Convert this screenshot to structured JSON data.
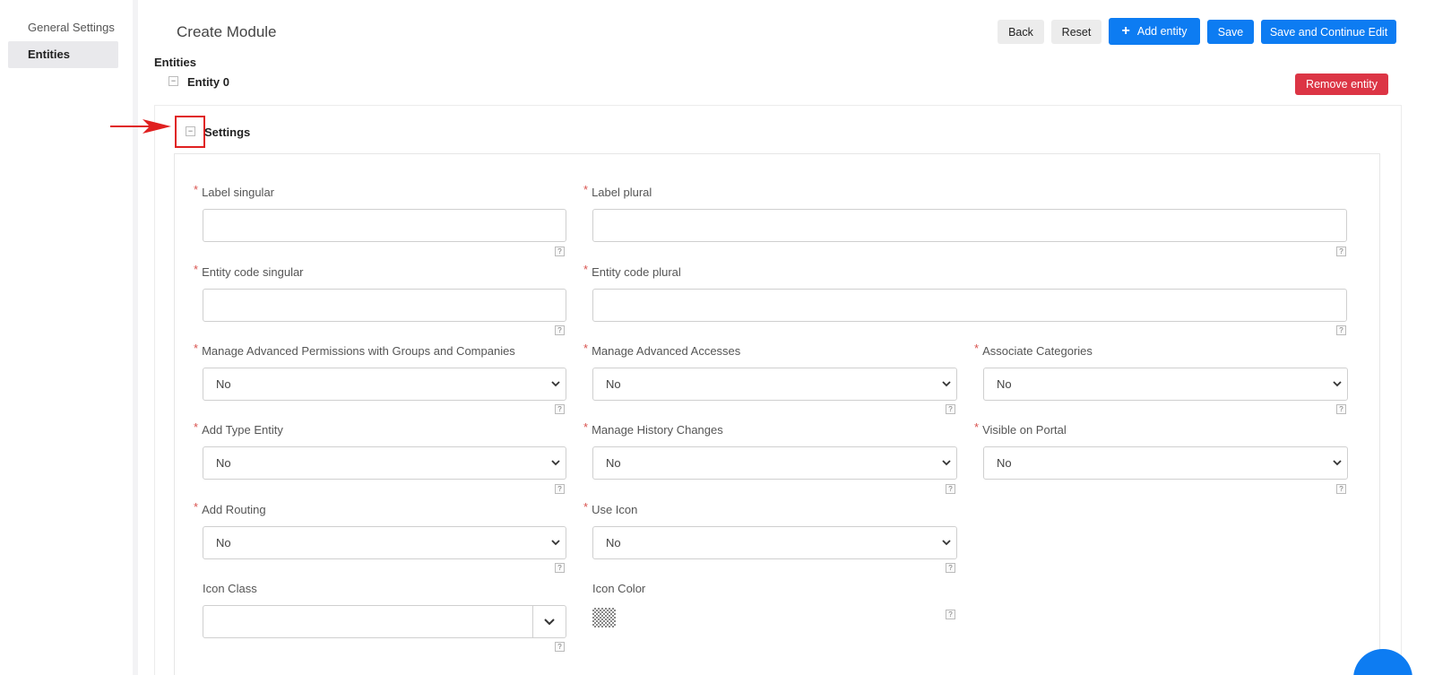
{
  "sidebar": {
    "items": [
      {
        "label": "General Settings"
      },
      {
        "label": "Entities"
      }
    ]
  },
  "header": {
    "title": "Create Module",
    "buttons": {
      "back": "Back",
      "reset": "Reset",
      "add_entity": "Add entity",
      "save": "Save",
      "save_continue": "Save and Continue Edit"
    }
  },
  "entities": {
    "section_title": "Entities",
    "entity_title": "Entity 0",
    "remove_label": "Remove entity",
    "settings_title": "Settings"
  },
  "form": {
    "required_mark": "*",
    "help_mark": "?",
    "label_singular": {
      "label": "Label singular",
      "value": ""
    },
    "label_plural": {
      "label": "Label plural",
      "value": ""
    },
    "code_singular": {
      "label": "Entity code singular",
      "value": ""
    },
    "code_plural": {
      "label": "Entity code plural",
      "value": ""
    },
    "adv_permissions": {
      "label": "Manage Advanced Permissions with Groups and Companies",
      "value": "No"
    },
    "adv_accesses": {
      "label": "Manage Advanced Accesses",
      "value": "No"
    },
    "associate_categories": {
      "label": "Associate Categories",
      "value": "No"
    },
    "add_type_entity": {
      "label": "Add Type Entity",
      "value": "No"
    },
    "history_changes": {
      "label": "Manage History Changes",
      "value": "No"
    },
    "visible_portal": {
      "label": "Visible on Portal",
      "value": "No"
    },
    "add_routing": {
      "label": "Add Routing",
      "value": "No"
    },
    "use_icon": {
      "label": "Use Icon",
      "value": "No"
    },
    "icon_class": {
      "label": "Icon Class",
      "value": ""
    },
    "icon_color": {
      "label": "Icon Color"
    }
  }
}
